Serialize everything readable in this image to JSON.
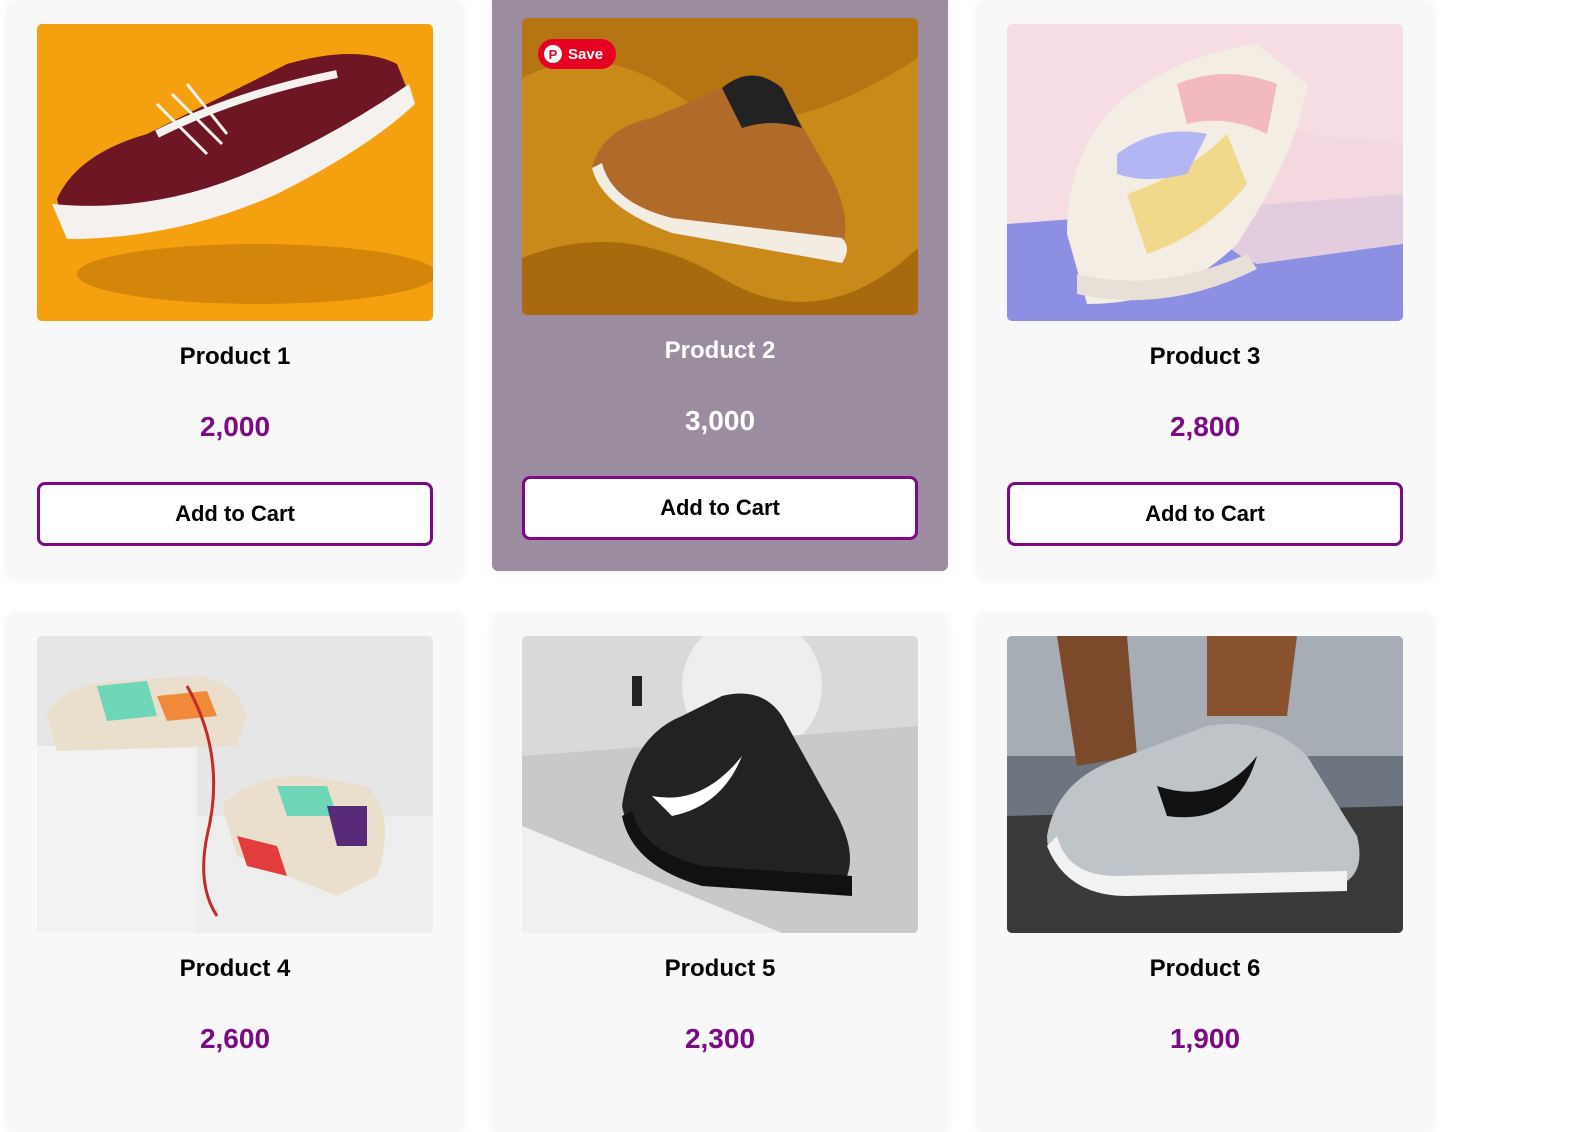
{
  "products": [
    {
      "name": "Product 1",
      "price": "2,000",
      "button": "Add to Cart"
    },
    {
      "name": "Product 2",
      "price": "3,000",
      "button": "Add to Cart",
      "save_label": "Save"
    },
    {
      "name": "Product 3",
      "price": "2,800",
      "button": "Add to Cart"
    },
    {
      "name": "Product 4",
      "price": "2,600"
    },
    {
      "name": "Product 5",
      "price": "2,300"
    },
    {
      "name": "Product 6",
      "price": "1,900"
    }
  ],
  "colors": {
    "accent": "#7b0a84",
    "card_bg": "#f8f8f8",
    "card_hover_bg": "#9c8ca0",
    "pinterest": "#e60023"
  }
}
